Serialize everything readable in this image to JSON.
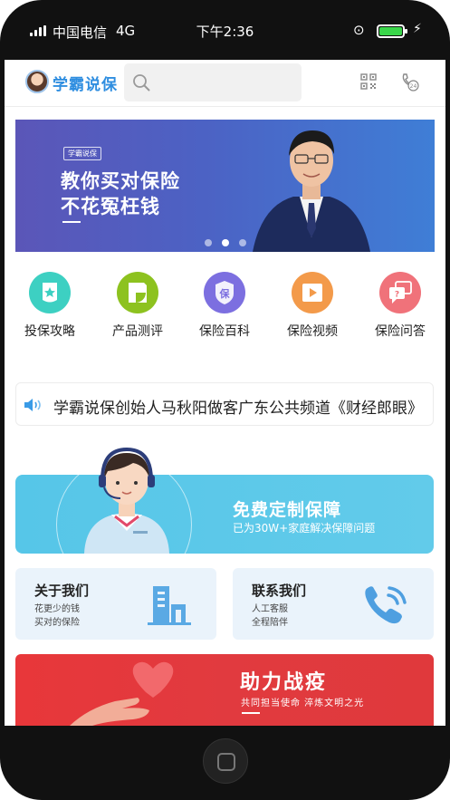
{
  "status_bar": {
    "carrier": "中国电信",
    "network": "4G",
    "time": "下午2:36",
    "battery_level": 1.0
  },
  "header": {
    "logo_text": "学霸说保",
    "search_placeholder": "",
    "icons": [
      "qr-code-icon",
      "service-24h-icon"
    ]
  },
  "banner": {
    "tag": "学霸说保",
    "line1": "教你买对保险",
    "line2": "不花冤枉钱",
    "slides": 3,
    "active_slide": 2
  },
  "categories": [
    {
      "label": "投保攻略",
      "icon": "star-shield-icon",
      "color": "#3dd0c2"
    },
    {
      "label": "产品测评",
      "icon": "review-icon",
      "color": "#8dc21f"
    },
    {
      "label": "保险百科",
      "icon": "shield-bao-icon",
      "color": "#7c6fe0"
    },
    {
      "label": "保险视频",
      "icon": "video-icon",
      "color": "#f39a4a"
    },
    {
      "label": "保险问答",
      "icon": "qa-icon",
      "color": "#f0727a"
    }
  ],
  "notice": {
    "text": "学霸说保创始人马秋阳做客广东公共频道《财经郎眼》"
  },
  "free_plan": {
    "title": "免费定制保障",
    "subtitle": "已为30W+家庭解决保障问题"
  },
  "about": {
    "title": "关于我们",
    "line1": "花更少的钱",
    "line2": "买对的保险"
  },
  "contact": {
    "title": "联系我们",
    "line1": "人工客服",
    "line2": "全程陪伴"
  },
  "fight": {
    "title": "助力战疫",
    "subtitle": "共同担当使命  淬炼文明之光"
  },
  "colors": {
    "brand_blue": "#2f8ee0",
    "free_card": "#56c6e8",
    "fight_card": "#e13a3f",
    "soft_card": "#eaf3fb"
  }
}
